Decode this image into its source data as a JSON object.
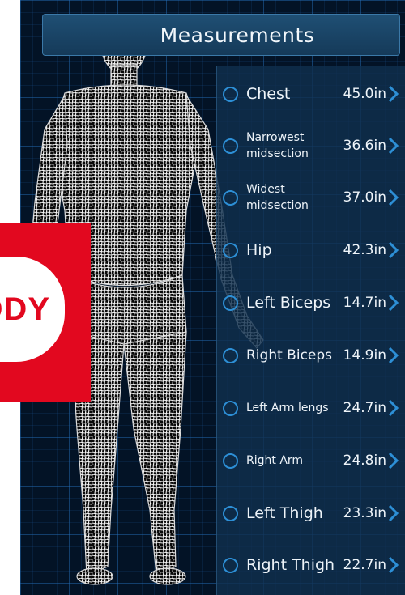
{
  "header": {
    "title": "Measurements"
  },
  "measurements": [
    {
      "label": "Chest",
      "value": "45.0in"
    },
    {
      "label": "Narrowest",
      "label2": "midsection",
      "value": "36.6in"
    },
    {
      "label": "Widest",
      "label2": "midsection",
      "value": "37.0in"
    },
    {
      "label": "Hip",
      "value": "42.3in"
    },
    {
      "label": "Left Biceps",
      "value": "14.7in"
    },
    {
      "label": "Right Biceps",
      "value": "14.9in"
    },
    {
      "label": "Left Arm lengs",
      "value": "24.7in"
    },
    {
      "label": "Right Arm",
      "value": "24.8in"
    },
    {
      "label": "Left Thigh",
      "value": "23.3in"
    },
    {
      "label": "Right Thigh",
      "value": "22.7in"
    }
  ],
  "brand": {
    "text": "ODY"
  },
  "colors": {
    "background": "#031326",
    "accent": "#2d8fd6",
    "brand_red": "#e2081f"
  },
  "icons": {
    "row_radio": "radio-circle-icon",
    "row_chevron": "chevron-right-icon"
  }
}
